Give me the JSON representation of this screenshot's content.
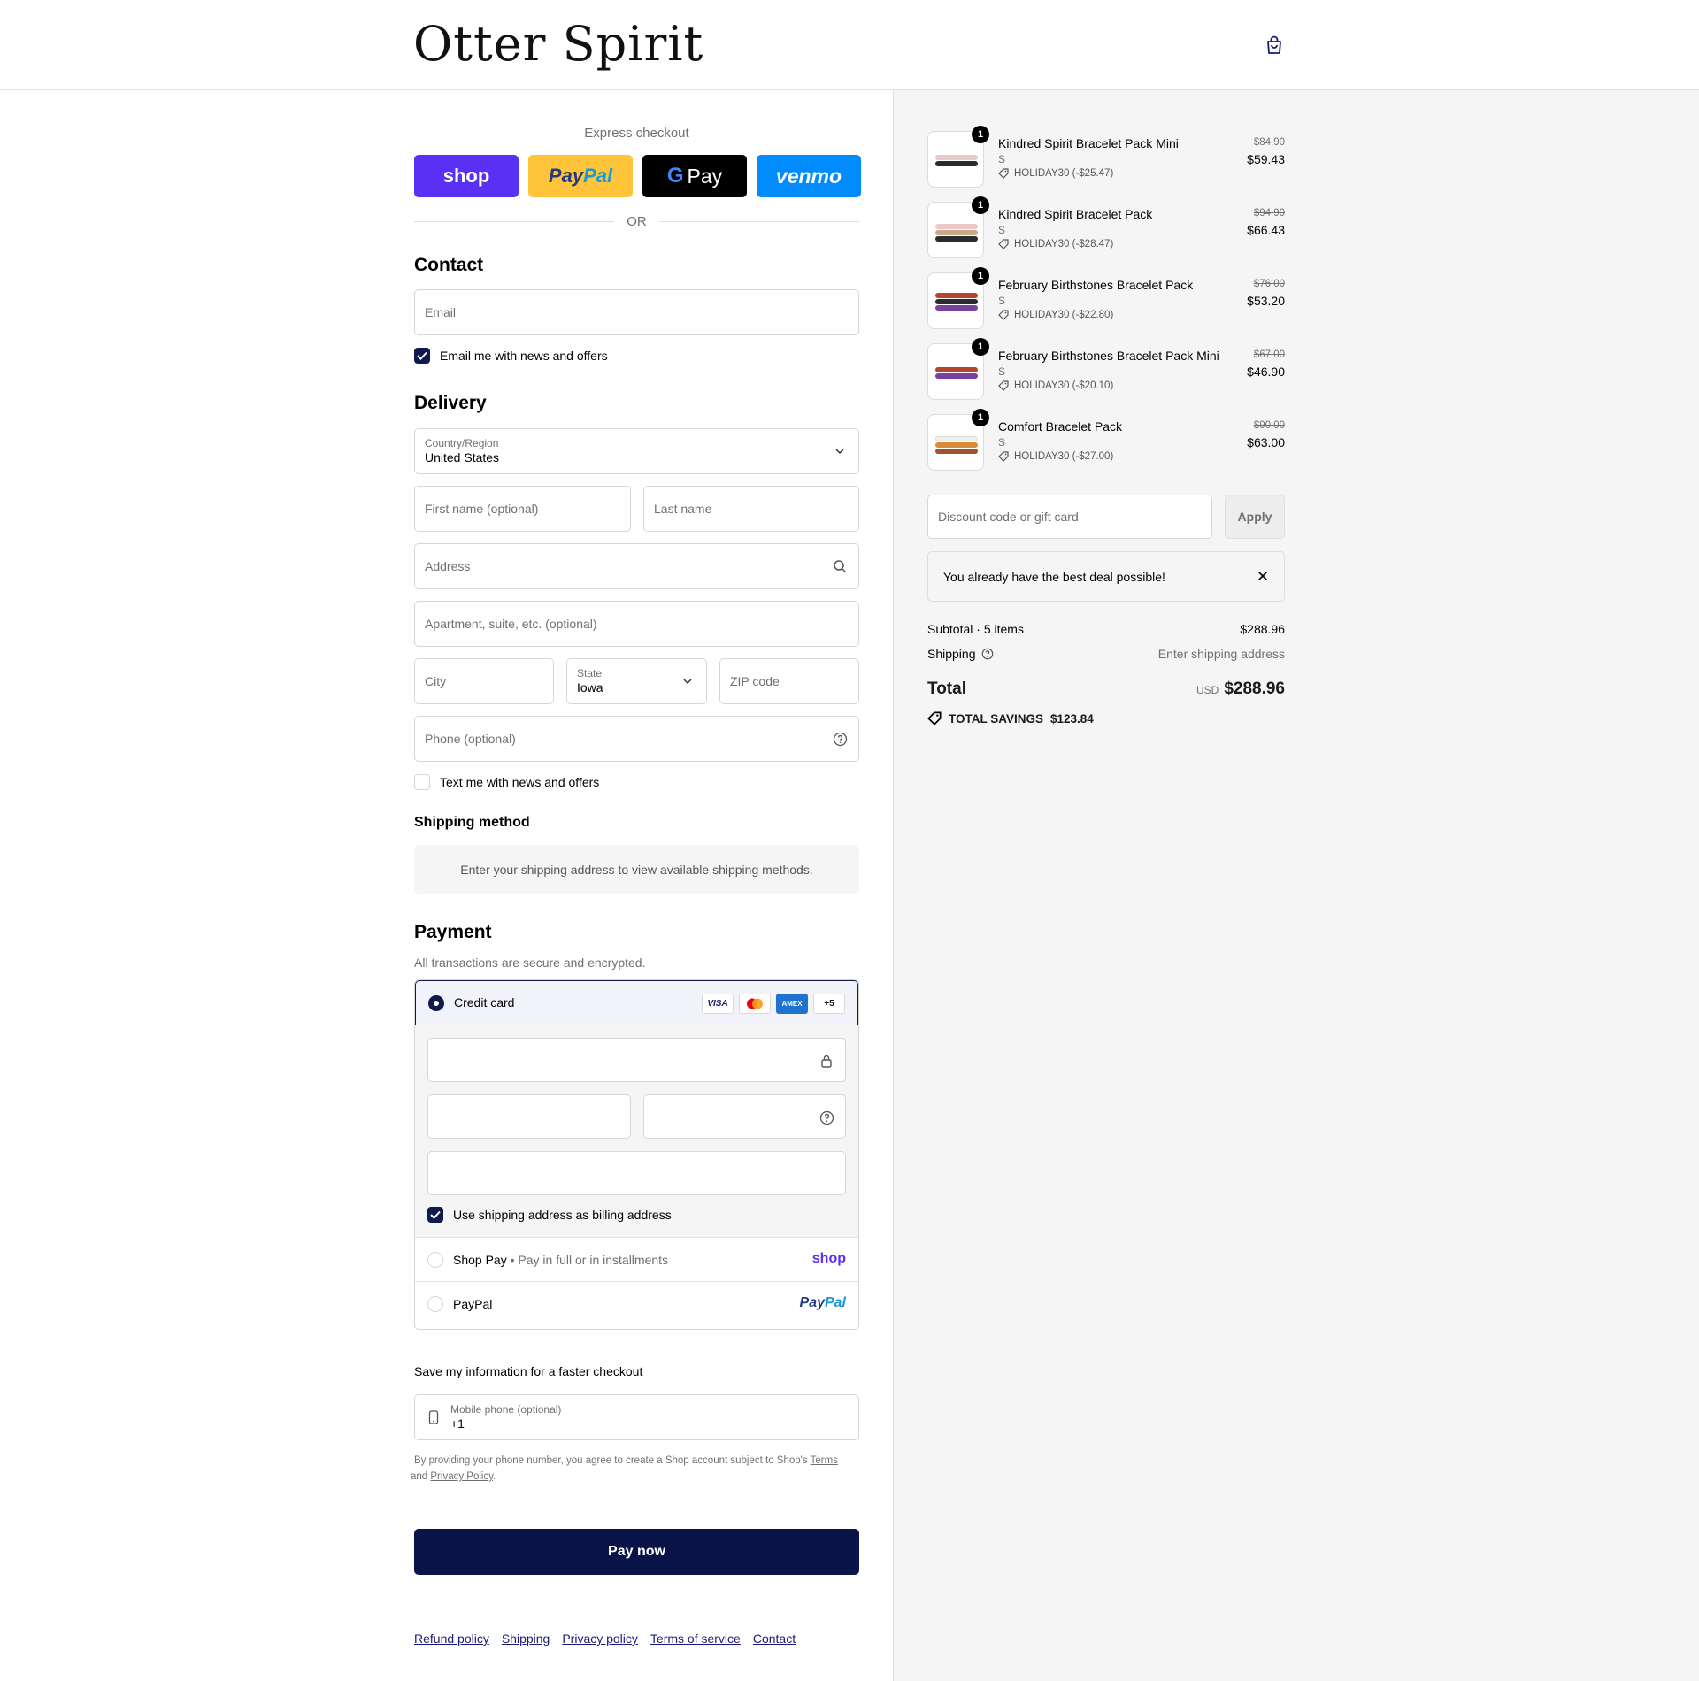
{
  "brand": {
    "logo": "Otter Spirit"
  },
  "header": {
    "cart_icon": "shopping-bag-icon"
  },
  "express": {
    "title": "Express checkout",
    "buttons": {
      "shop": "shop",
      "paypal_a": "Pay",
      "paypal_b": "Pal",
      "gpay": "Pay",
      "venmo": "venmo"
    },
    "or": "OR"
  },
  "contact": {
    "heading": "Contact",
    "email_placeholder": "Email",
    "news_label": "Email me with news and offers"
  },
  "delivery": {
    "heading": "Delivery",
    "country_label": "Country/Region",
    "country_value": "United States",
    "first_name": "First name (optional)",
    "last_name": "Last name",
    "address": "Address",
    "apartment": "Apartment, suite, etc. (optional)",
    "city": "City",
    "state_label": "State",
    "state_value": "Iowa",
    "zip": "ZIP code",
    "phone": "Phone (optional)",
    "text_label": "Text me with news and offers"
  },
  "shipping_method": {
    "heading": "Shipping method",
    "note": "Enter your shipping address to view available shipping methods."
  },
  "payment": {
    "heading": "Payment",
    "subtitle": "All transactions are secure and encrypted.",
    "credit_card_label": "Credit card",
    "card_brands": [
      "VISA",
      "",
      "AMEX",
      "+5"
    ],
    "billing_label": "Use shipping address as billing address",
    "shop_pay_label": "Shop Pay",
    "shop_pay_sub": "Pay in full or in installments",
    "shop_pay_logo": "shop",
    "paypal_label": "PayPal",
    "paypal_logo_a": "Pay",
    "paypal_logo_b": "Pal"
  },
  "save_info": {
    "title": "Save my information for a faster checkout",
    "mobile_label": "Mobile phone (optional)",
    "mobile_value": "+1",
    "legal_pre": "By providing your phone number, you agree to create a Shop account subject to Shop's ",
    "legal_terms": "Terms",
    "legal_and": " and ",
    "legal_privacy": "Privacy Policy",
    "legal_end": "."
  },
  "pay_now": "Pay now",
  "footer_links": [
    "Refund policy",
    "Shipping",
    "Privacy policy",
    "Terms of service",
    "Contact"
  ],
  "cart": {
    "items": [
      {
        "qty": "1",
        "name": "Kindred Spirit Bracelet Pack Mini",
        "variant": "S",
        "discount": "HOLIDAY30 (-$25.47)",
        "old_price": "$84.90",
        "price": "$59.43"
      },
      {
        "qty": "1",
        "name": "Kindred Spirit Bracelet Pack",
        "variant": "S",
        "discount": "HOLIDAY30 (-$28.47)",
        "old_price": "$94.90",
        "price": "$66.43"
      },
      {
        "qty": "1",
        "name": "February Birthstones Bracelet Pack",
        "variant": "S",
        "discount": "HOLIDAY30 (-$22.80)",
        "old_price": "$76.00",
        "price": "$53.20"
      },
      {
        "qty": "1",
        "name": "February Birthstones Bracelet Pack Mini",
        "variant": "S",
        "discount": "HOLIDAY30 (-$20.10)",
        "old_price": "$67.00",
        "price": "$46.90"
      },
      {
        "qty": "1",
        "name": "Comfort Bracelet Pack",
        "variant": "S",
        "discount": "HOLIDAY30 (-$27.00)",
        "old_price": "$90.00",
        "price": "$63.00"
      }
    ],
    "discount_placeholder": "Discount code or gift card",
    "apply": "Apply",
    "notice": "You already have the best deal possible!",
    "subtotal_label": "Subtotal · 5 items",
    "subtotal_value": "$288.96",
    "shipping_label": "Shipping",
    "shipping_value": "Enter shipping address",
    "total_label": "Total",
    "currency": "USD",
    "total_value": "$288.96",
    "savings_label": "TOTAL SAVINGS",
    "savings_value": "$123.84"
  },
  "colors": {
    "accent": "#101a4d",
    "pay_button": "#0a1448",
    "shop": "#5a31f4",
    "paypal": "#ffc439",
    "venmo": "#008cff"
  }
}
